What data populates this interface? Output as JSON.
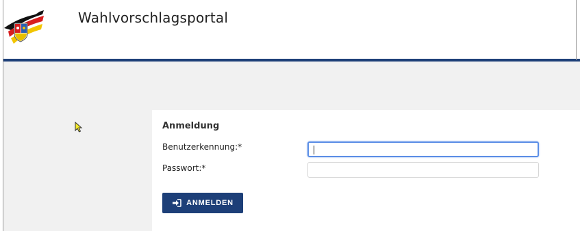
{
  "header": {
    "title": "Wahlvorschlagsportal",
    "logo_icon": "rlp-flag-logo-icon"
  },
  "login": {
    "title": "Anmeldung",
    "username_label": "Benutzerkennung:*",
    "username_value": "",
    "password_label": "Passwort:*",
    "password_value": "",
    "submit_label": "ANMELDEN",
    "submit_icon": "sign-in-icon"
  },
  "colors": {
    "brand": "#1d3f78",
    "focus_border": "#5b8ee6",
    "background": "#f1f1f1"
  }
}
